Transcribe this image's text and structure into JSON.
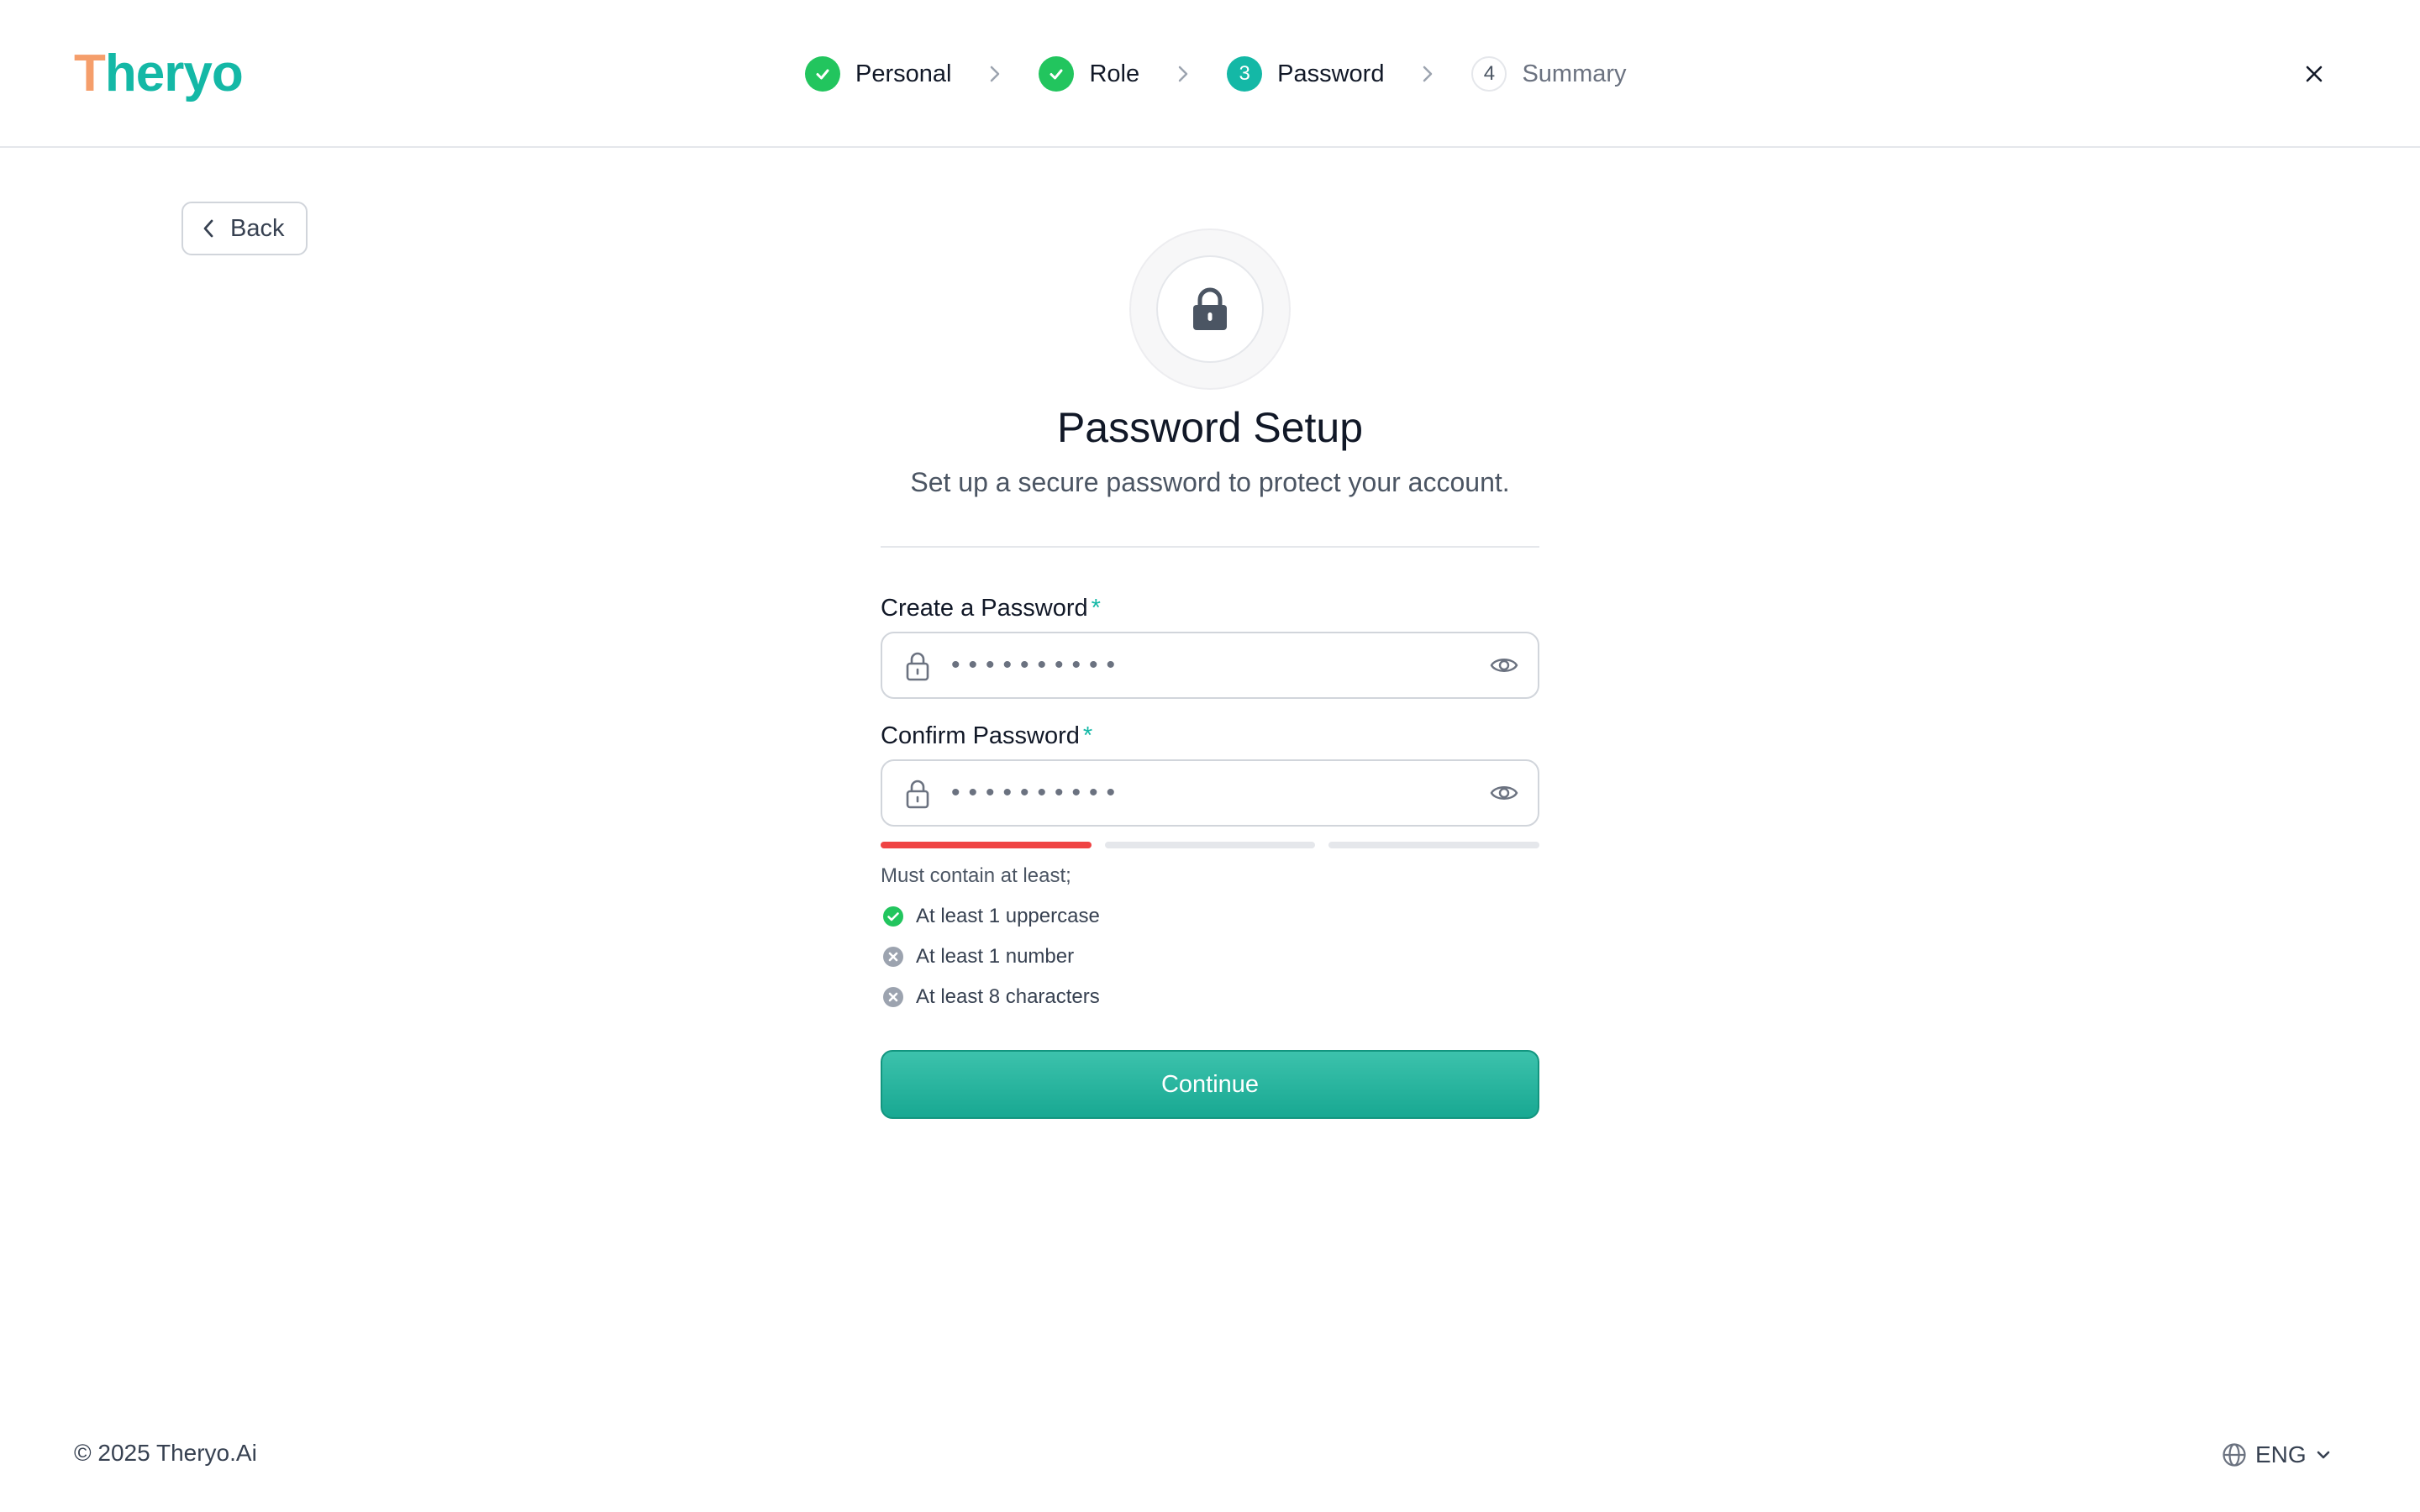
{
  "brand": {
    "logo_first": "T",
    "logo_rest": "heryo",
    "accent": "#14b8a6",
    "logo_first_color": "#f59e6b"
  },
  "stepper": {
    "steps": [
      {
        "number": "1",
        "label": "Personal",
        "status": "done"
      },
      {
        "number": "2",
        "label": "Role",
        "status": "done"
      },
      {
        "number": "3",
        "label": "Password",
        "status": "active"
      },
      {
        "number": "4",
        "label": "Summary",
        "status": "pending"
      }
    ],
    "done_color": "#22c55e"
  },
  "back": {
    "label": "Back"
  },
  "hero": {
    "icon": "lock-icon"
  },
  "page": {
    "title": "Password Setup",
    "subtitle": "Set up a secure password to protect your account."
  },
  "form": {
    "password": {
      "label": "Create a Password",
      "required_mark": "*",
      "masked_value": "••••••••••"
    },
    "confirm": {
      "label": "Confirm Password",
      "required_mark": "*",
      "masked_value": "••••••••••"
    },
    "strength": {
      "filled_segments": 1,
      "total_segments": 3,
      "color": "#ef4444"
    },
    "rules_title": "Must contain at least;",
    "rules": [
      {
        "text": "At least 1 uppercase",
        "met": true
      },
      {
        "text": "At least 1 number",
        "met": false
      },
      {
        "text": "At least 8 characters",
        "met": false
      }
    ],
    "continue_label": "Continue"
  },
  "footer": {
    "copyright": "© 2025 Theryo.Ai",
    "language": "ENG"
  }
}
